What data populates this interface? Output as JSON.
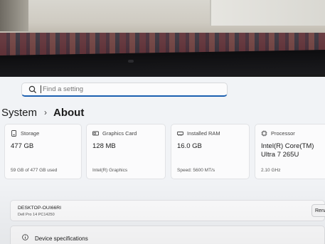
{
  "search": {
    "placeholder": "Find a setting"
  },
  "breadcrumb": {
    "parent": "System",
    "separator": "›",
    "current": "About"
  },
  "cards": [
    {
      "title": "Storage",
      "value": "477 GB",
      "detail": "59 GB of 477 GB used",
      "icon": "storage-icon"
    },
    {
      "title": "Graphics Card",
      "value": "128 MB",
      "detail": "Intel(R) Graphics",
      "icon": "graphics-card-icon"
    },
    {
      "title": "Installed RAM",
      "value": "16.0 GB",
      "detail": "Speed: 5600 MT/s",
      "icon": "ram-icon"
    },
    {
      "title": "Processor",
      "value": "Intel(R) Core(TM) Ultra 7 265U",
      "detail": "2.10 GHz",
      "icon": "processor-icon"
    }
  ],
  "device": {
    "name": "DESKTOP-OUI66RI",
    "model": "Dell Pro 14 PC14250",
    "rename_label": "Rena"
  },
  "specs": {
    "label": "Device specifications",
    "icon": "info-icon"
  },
  "colors": {
    "accent": "#1b5fb0",
    "background": "#f1f3f6",
    "card": "#fbfbfc"
  }
}
